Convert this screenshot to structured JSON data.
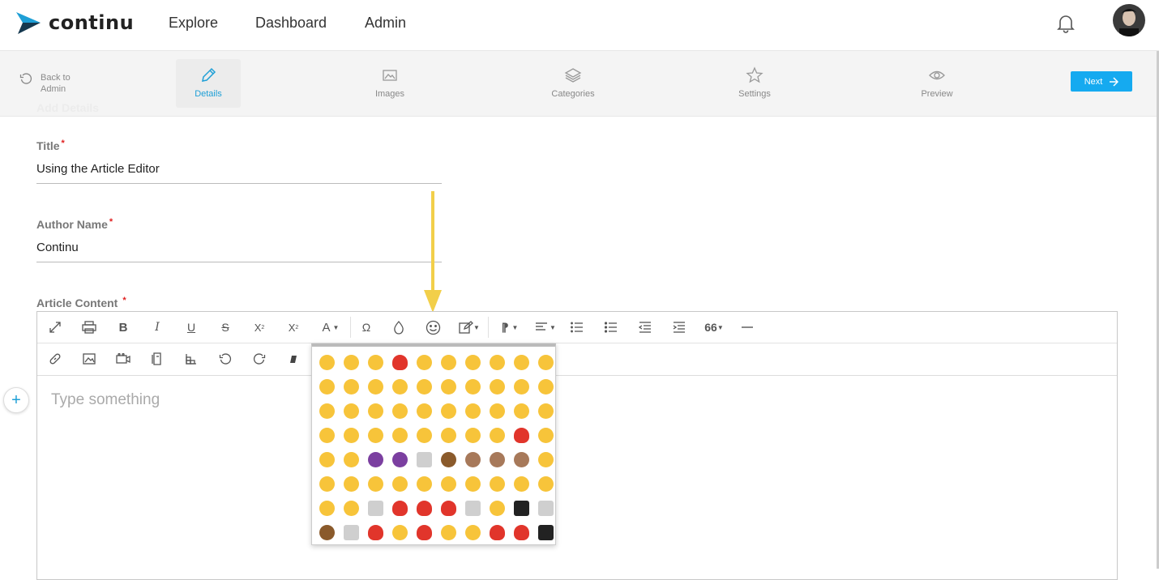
{
  "brand": {
    "name": "continu",
    "accent": "#1e9fd6"
  },
  "nav": {
    "explore": "Explore",
    "dashboard": "Dashboard",
    "admin": "Admin"
  },
  "steps": {
    "back": "Back to Admin",
    "details": "Details",
    "images": "Images",
    "categories": "Categories",
    "settings": "Settings",
    "preview": "Preview",
    "next": "Next"
  },
  "form": {
    "section_heading": "Add Details",
    "title_label": "Title",
    "title_value": "Using the Article Editor",
    "author_label": "Author Name",
    "author_value": "Continu",
    "content_label": "Article Content",
    "required_mark": "*",
    "content_placeholder": "Type something"
  },
  "toolbar": {
    "row1": [
      "fullscreen-icon",
      "print-icon",
      "bold-icon",
      "italic-icon",
      "underline-icon",
      "strikethrough-icon",
      "subscript-icon",
      "superscript-icon",
      "font-color-icon",
      "special-char-icon",
      "ink-icon",
      "emoji-icon",
      "edit-icon",
      "paragraph-icon",
      "align-icon",
      "ordered-list-icon",
      "unordered-list-icon",
      "outdent-icon",
      "indent-icon",
      "quote-icon",
      "horizontal-rule-icon"
    ],
    "row2": [
      "link-icon",
      "image-icon",
      "video-icon",
      "file-icon",
      "table-icon",
      "undo-icon",
      "redo-icon",
      "clear-format-icon"
    ]
  },
  "emoji_colors": {
    "face": "#f7c43a",
    "red": "#e1352b",
    "purple": "#7b3fa0",
    "brown": "#8a5a2b",
    "monkey": "#a7795a",
    "gray": "#cfcfcf",
    "black": "#222222"
  },
  "emojis": [
    "face",
    "face",
    "face",
    "red",
    "face",
    "face",
    "face",
    "face",
    "face",
    "face",
    "face",
    "face",
    "face",
    "face",
    "face",
    "face",
    "face",
    "face",
    "face",
    "face",
    "face",
    "face",
    "face",
    "face",
    "face",
    "face",
    "face",
    "face",
    "face",
    "face",
    "face",
    "face",
    "face",
    "face",
    "face",
    "face",
    "face",
    "face",
    "red",
    "face",
    "face",
    "face",
    "purple",
    "purple",
    "gray",
    "brown",
    "monkey",
    "monkey",
    "monkey",
    "face",
    "face",
    "face",
    "face",
    "face",
    "face",
    "face",
    "face",
    "face",
    "face",
    "face",
    "face",
    "face",
    "gray",
    "red",
    "red",
    "red",
    "gray",
    "face",
    "black",
    "gray",
    "brown",
    "gray",
    "red",
    "face",
    "red",
    "face",
    "face",
    "red",
    "red",
    "black"
  ]
}
